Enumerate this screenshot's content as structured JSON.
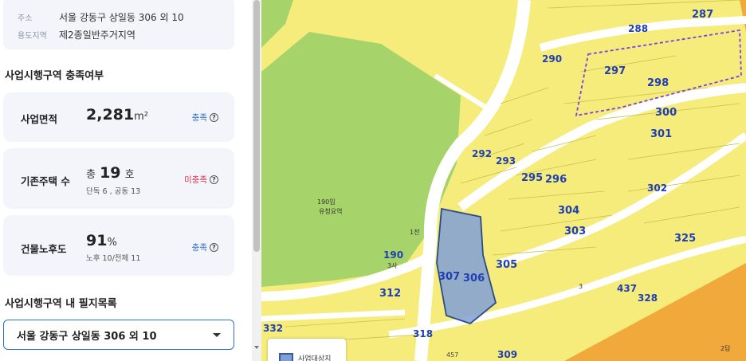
{
  "address_card": {
    "address_label": "주소",
    "address_value": "서울 강동구 상일동 306 외 10",
    "zone_label": "용도지역",
    "zone_value": "제2종일반주거지역"
  },
  "requirements": {
    "title": "사업시행구역 충족여부",
    "area": {
      "label": "사업면적",
      "value": "2,281",
      "unit": "m²",
      "status": "충족"
    },
    "houses": {
      "label": "기존주택 수",
      "prefix": "총",
      "value": "19",
      "unit": "호",
      "detail": "단독 6 , 공동 13",
      "status": "미충족"
    },
    "aging": {
      "label": "건물노후도",
      "value": "91",
      "unit": "%",
      "detail": "노후 10/전체 11",
      "status": "충족"
    }
  },
  "parcel_list": {
    "title": "사업시행구역 내 필지목록",
    "selected": "서울 강동구 상일동 306 외 10"
  },
  "map": {
    "legend_label": "사업대상지",
    "colors": {
      "residential": "#f5ec7c",
      "park": "#a6d46a",
      "road": "#ffffff",
      "target": "#7fa0d6",
      "commercial": "#f2a93b"
    },
    "labels": {
      "l287": "287",
      "l288": "288",
      "l290": "290",
      "l297": "297",
      "l298": "298",
      "l300": "300",
      "l301": "301",
      "l292": "292",
      "l293": "293",
      "l295": "295",
      "l296": "296",
      "l304": "304",
      "l303": "303",
      "l302": "302",
      "l305": "305",
      "l307": "307",
      "l306": "306",
      "l312": "312",
      "l318": "318",
      "l325": "325",
      "l328": "328",
      "l332": "332",
      "l437": "437",
      "l457": "457",
      "l309": "309",
      "l190": "190",
      "l190b": "190임",
      "l3sa": "3사",
      "lyuchi": "유청요역",
      "lsmall1": "1전",
      "l3": "3",
      "l2jeon": "2답"
    }
  }
}
